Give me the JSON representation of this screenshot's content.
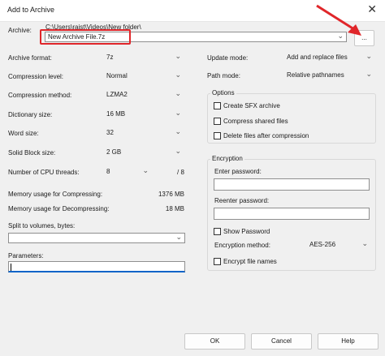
{
  "window": {
    "title": "Add to Archive",
    "close_glyph": "✕"
  },
  "archive": {
    "label": "Archive:",
    "path": "C:\\Users\\raist\\Videos\\New folder\\",
    "value": "New Archive File.7z",
    "browse_label": "..."
  },
  "left": {
    "rows": [
      {
        "label": "Archive format:",
        "value": "7z"
      },
      {
        "label": "Compression level:",
        "value": "Normal"
      },
      {
        "label": "Compression method:",
        "value": "LZMA2"
      },
      {
        "label": "Dictionary size:",
        "value": "16 MB"
      },
      {
        "label": "Word size:",
        "value": "32"
      },
      {
        "label": "Solid Block size:",
        "value": "2 GB"
      }
    ],
    "threads": {
      "label": "Number of CPU threads:",
      "value": "8",
      "max": "/ 8"
    },
    "memory": [
      {
        "label": "Memory usage for Compressing:",
        "value": "1376 MB"
      },
      {
        "label": "Memory usage for Decompressing:",
        "value": "18 MB"
      }
    ],
    "split_label": "Split to volumes, bytes:",
    "parameters_label": "Parameters:"
  },
  "right": {
    "update_mode": {
      "label": "Update mode:",
      "value": "Add and replace files"
    },
    "path_mode": {
      "label": "Path mode:",
      "value": "Relative pathnames"
    },
    "options": {
      "title": "Options",
      "items": [
        "Create SFX archive",
        "Compress shared files",
        "Delete files after compression"
      ]
    },
    "encryption": {
      "title": "Encryption",
      "enter_password": "Enter password:",
      "reenter_password": "Reenter password:",
      "show_password": "Show Password",
      "method_label": "Encryption method:",
      "method_value": "AES-256",
      "encrypt_names": "Encrypt file names"
    }
  },
  "buttons": {
    "ok": "OK",
    "cancel": "Cancel",
    "help": "Help"
  },
  "annotation_color": "#e0262a"
}
